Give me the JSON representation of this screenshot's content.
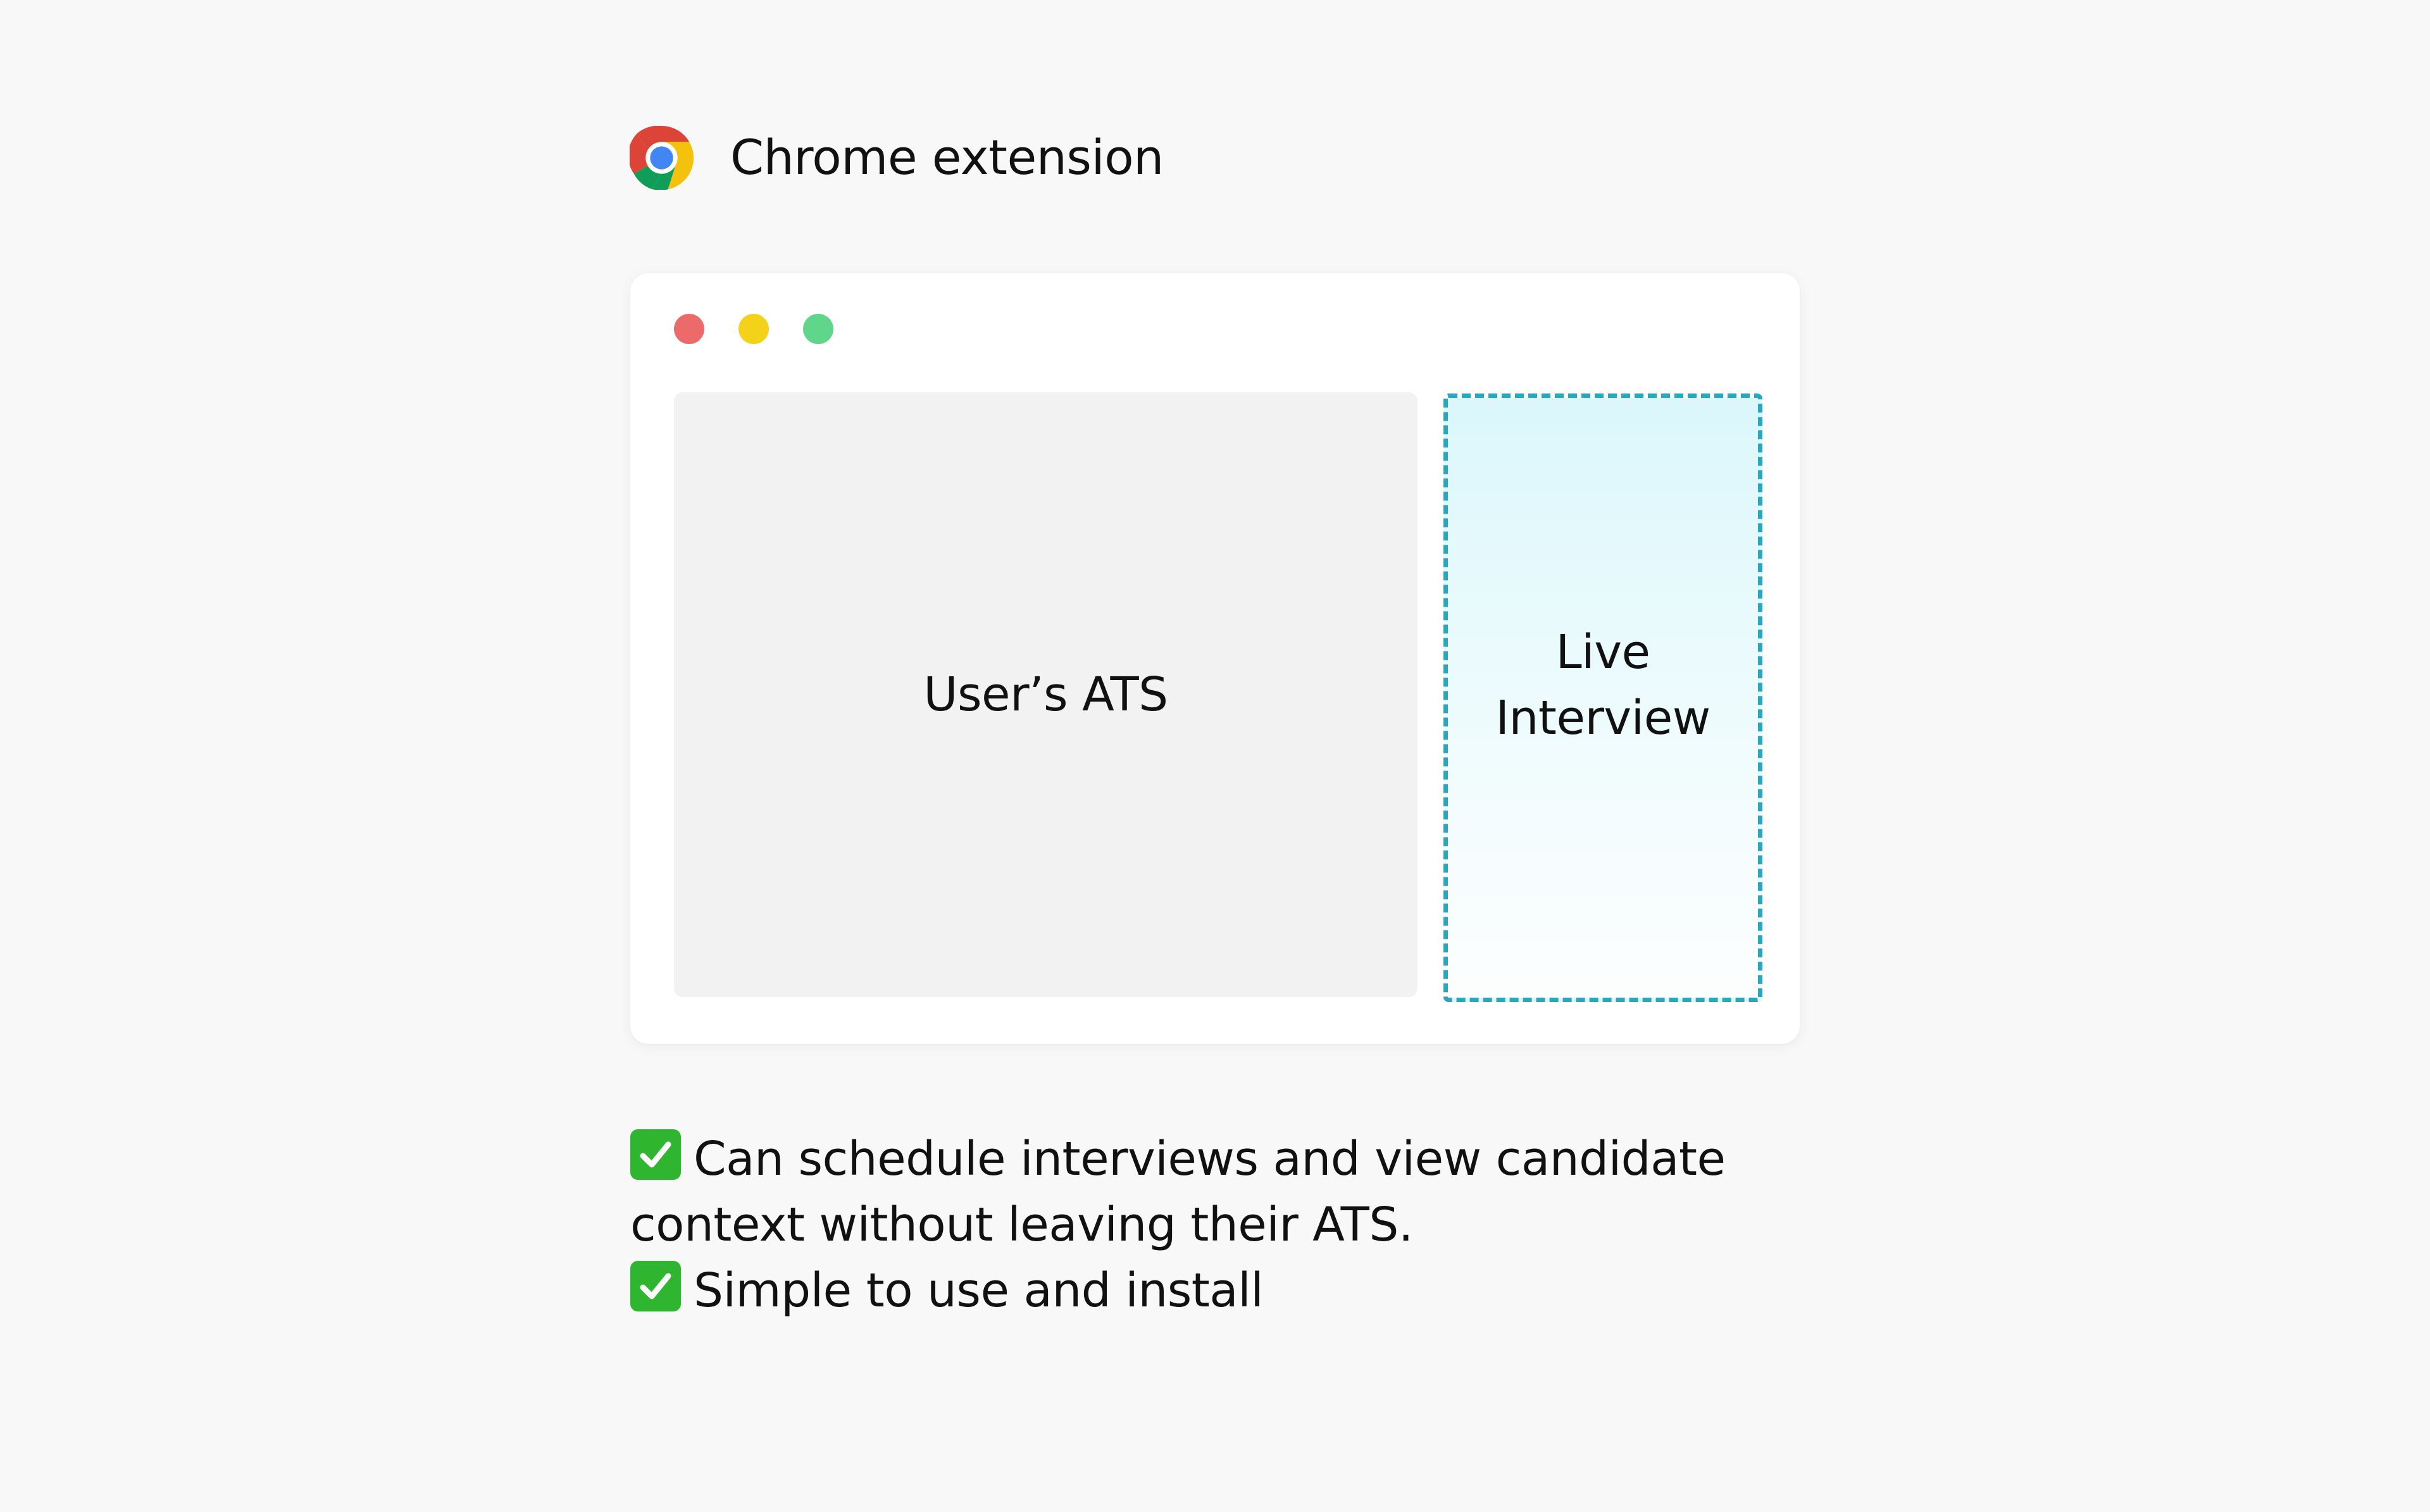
{
  "header": {
    "icon": "chrome-logo-icon",
    "title": "Chrome extension"
  },
  "window": {
    "controls": [
      {
        "name": "close",
        "color": "#ec6a6a"
      },
      {
        "name": "minimize",
        "color": "#f5d21a"
      },
      {
        "name": "maximize",
        "color": "#5fd68a"
      }
    ],
    "ats_panel": {
      "label": "User’s ATS"
    },
    "live_panel": {
      "label": "Live\nInterview",
      "border_color": "#2aa7c0"
    }
  },
  "features": [
    {
      "icon": "check-mark-icon",
      "text": "Can schedule interviews and view candidate context without leaving their ATS."
    },
    {
      "icon": "check-mark-icon",
      "text": "Simple to use and install"
    }
  ],
  "colors": {
    "background": "#f8f8f8",
    "check_green": "#2fb52f",
    "chrome_red": "#db4437",
    "chrome_yellow": "#f4c20d",
    "chrome_green": "#0f9d58",
    "chrome_blue": "#4285f4"
  }
}
